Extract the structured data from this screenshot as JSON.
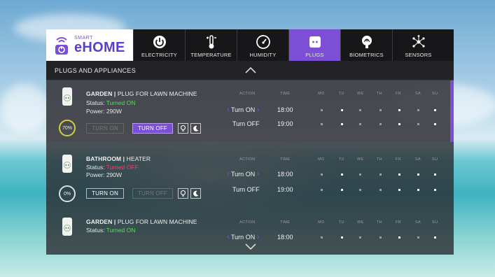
{
  "brand": {
    "small": "SMART",
    "name": "eHOME"
  },
  "nav": {
    "tabs": [
      {
        "label": "ELECTRICITY",
        "icon": "power-icon",
        "active": false
      },
      {
        "label": "TEMPERATURE",
        "icon": "thermometer-icon",
        "active": false
      },
      {
        "label": "HUMIDITY",
        "icon": "gauge-icon",
        "active": false
      },
      {
        "label": "PLUGS",
        "icon": "plug-icon",
        "active": true
      },
      {
        "label": "BIOMETRICS",
        "icon": "fingerprint-icon",
        "active": false
      },
      {
        "label": "SENSORS",
        "icon": "network-icon",
        "active": false
      }
    ]
  },
  "section": {
    "title": "PLUGS AND APPLIANCES"
  },
  "columns": {
    "action": "ACTION",
    "time": "TIME",
    "days": [
      "MO",
      "TU",
      "WE",
      "TH",
      "FR",
      "SA",
      "SU"
    ]
  },
  "devices": [
    {
      "room": "GARDEN",
      "name": "PLUG FOR LAWN MACHINE",
      "status_label": "Status: ",
      "status": "Turned ON",
      "power": "Power: 290W",
      "level": "70%",
      "btn_on": "TURN ON",
      "btn_off": "TURN OFF",
      "schedule": [
        {
          "action": "Turn ON",
          "time": "18:00",
          "days": [
            0,
            1,
            0,
            0,
            1,
            0,
            1
          ]
        },
        {
          "action": "Turn OFF",
          "time": "19:00",
          "days": [
            0,
            1,
            0,
            0,
            1,
            0,
            1
          ]
        }
      ]
    },
    {
      "room": "BATHROOM",
      "name": "HEATER",
      "status_label": "Status: ",
      "status": "Turned OFF",
      "power": "Power: 290W",
      "level": "0%",
      "btn_on": "TURN ON",
      "btn_off": "TURN OFF",
      "schedule": [
        {
          "action": "Turn ON",
          "time": "18:00",
          "days": [
            0,
            1,
            0,
            0,
            1,
            1,
            1
          ]
        },
        {
          "action": "Turn OFF",
          "time": "19:00",
          "days": [
            0,
            1,
            0,
            0,
            1,
            1,
            1
          ]
        }
      ]
    },
    {
      "room": "GARDEN",
      "name": "PLUG FOR LAWN MACHINE",
      "status_label": "Status: ",
      "status": "Turned ON",
      "schedule": [
        {
          "action": "Turn ON",
          "time": "18:00",
          "days": [
            0,
            1,
            0,
            0,
            1,
            0,
            1
          ]
        }
      ]
    }
  ],
  "colors": {
    "accent": "#7d4fd6",
    "on": "#5ddc5d",
    "off": "#ff3b6b",
    "level_ring": "#d4cf3b"
  }
}
